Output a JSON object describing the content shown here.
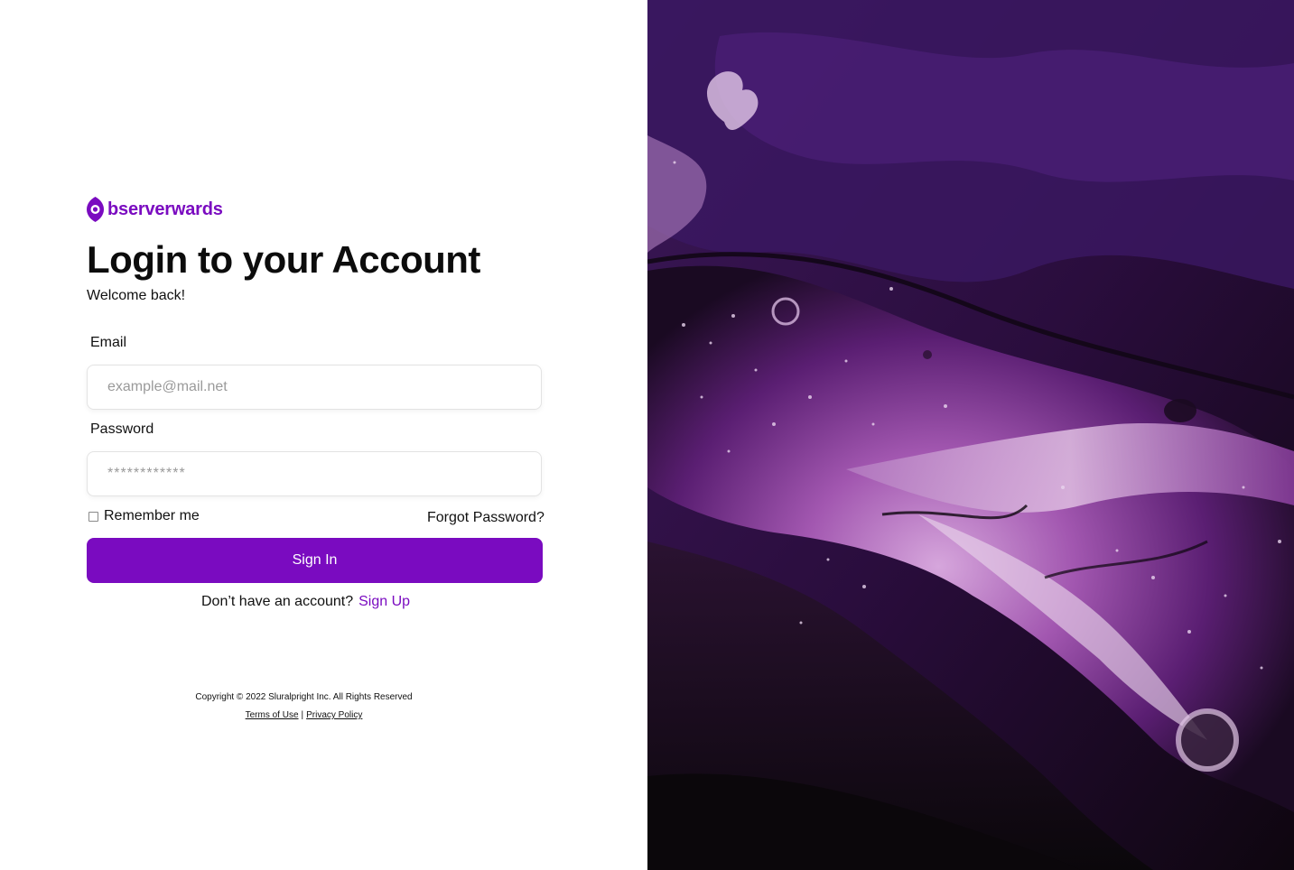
{
  "brand": {
    "name": "bserverwards",
    "logo_icon": "eye-pin-icon",
    "accent_color": "#7a0bc0"
  },
  "login": {
    "title": "Login to your Account",
    "subtitle": "Welcome back!",
    "email_label": "Email",
    "email_placeholder": "example@mail.net",
    "password_label": "Password",
    "password_placeholder": "************",
    "remember_label": "Remember me",
    "remember_checked": false,
    "forgot_label": "Forgot Password?",
    "signin_label": "Sign In",
    "no_account_text": "Don’t have an account?",
    "signup_label": "Sign Up"
  },
  "footer": {
    "copyright": "Copyright © 2022 Sluralpright Inc. All Rights Reserved",
    "terms_label": "Terms of Use",
    "separator": "|",
    "privacy_label": "Privacy Policy"
  },
  "hero": {
    "image_name": "purple-fluid-art-image"
  }
}
